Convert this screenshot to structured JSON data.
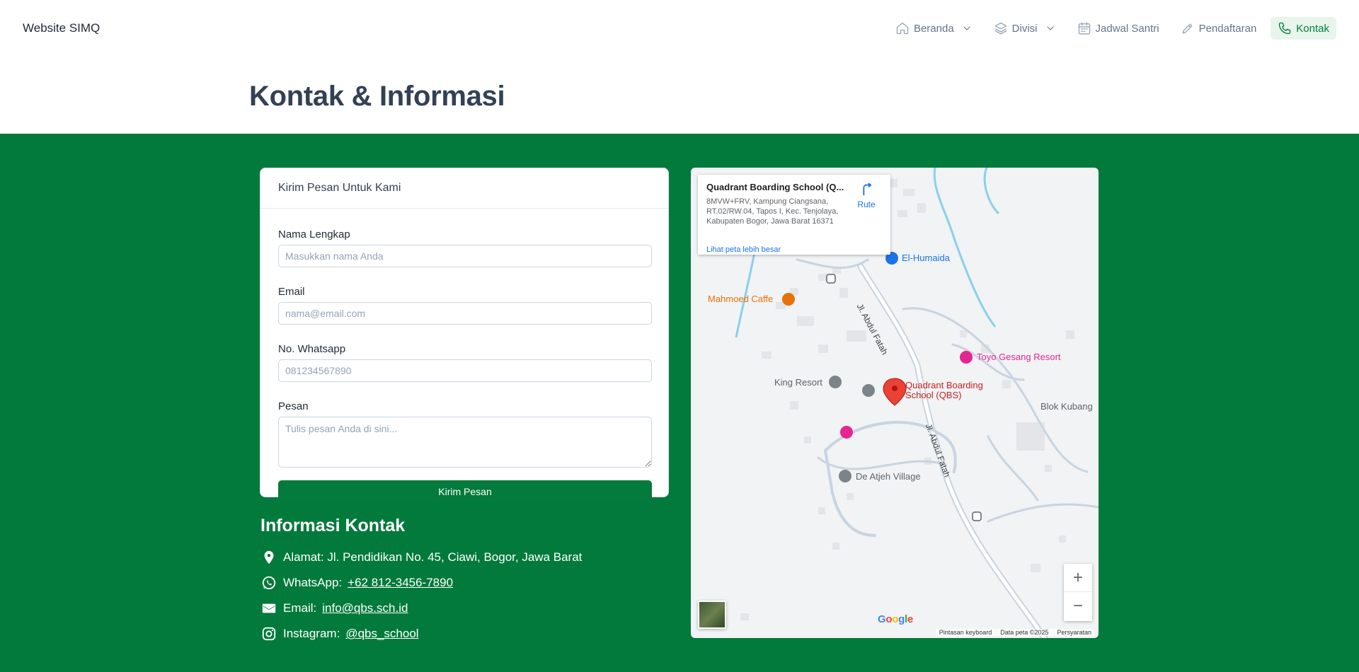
{
  "brand": "Website SIMQ",
  "nav": {
    "items": [
      {
        "label": "Beranda",
        "icon": "home-icon",
        "dropdown": true
      },
      {
        "label": "Divisi",
        "icon": "layers-icon",
        "dropdown": true
      },
      {
        "label": "Jadwal Santri",
        "icon": "calendar-icon",
        "dropdown": false
      },
      {
        "label": "Pendaftaran",
        "icon": "pencil-icon",
        "dropdown": false
      },
      {
        "label": "Kontak",
        "icon": "phone-icon",
        "dropdown": false,
        "active": true
      }
    ]
  },
  "page": {
    "title": "Kontak & Informasi"
  },
  "colors": {
    "primary": "#047a3c",
    "section_bg": "#027a3b",
    "active_bg": "#e7f5ec"
  },
  "form": {
    "header": "Kirim Pesan Untuk Kami",
    "name_label": "Nama Lengkap",
    "name_placeholder": "Masukkan nama Anda",
    "email_label": "Email",
    "email_placeholder": "nama@email.com",
    "whatsapp_label": "No. Whatsapp",
    "whatsapp_placeholder": "081234567890",
    "message_label": "Pesan",
    "message_placeholder": "Tulis pesan Anda di sini...",
    "submit_label": "Kirim Pesan"
  },
  "info": {
    "title": "Informasi Kontak",
    "address": "Alamat: Jl. Pendidikan No. 45, Ciawi, Bogor, Jawa Barat",
    "whatsapp_label": "WhatsApp:",
    "whatsapp_value": "+62 812-3456-7890",
    "email_label": "Email:",
    "email_value": "info@qbs.sch.id",
    "instagram_label": "Instagram:",
    "instagram_value": "@qbs_school"
  },
  "map": {
    "card_title": "Quadrant Boarding School (Q...",
    "card_address": "8MVW+FRV, Kampung Ciangsana, RT.02/RW.04, Tapos I, Kec. Tenjolaya, Kabupaten Bogor, Jawa Barat 16371",
    "card_link": "Lihat peta lebih besar",
    "route_label": "Rute",
    "places": {
      "el_humaida": "El-Humaida",
      "mahmoed": "Mahmoed Caffe",
      "toyo": "Toyo Gesang Resort",
      "king": "King Resort",
      "qbs_1": "Quadrant Boarding",
      "qbs_2": "School (QBS)",
      "blok": "Blok Kubang",
      "atjeh": "De Atjeh Village",
      "road_1": "Jl. Abdul Fatah",
      "road_2": "Jl. Abdul Fatah"
    },
    "zoom_in": "+",
    "zoom_out": "−",
    "google": "Google",
    "attrib": {
      "shortcuts": "Pintasan keyboard",
      "data": "Data peta ©2025",
      "terms": "Persyaratan"
    }
  }
}
